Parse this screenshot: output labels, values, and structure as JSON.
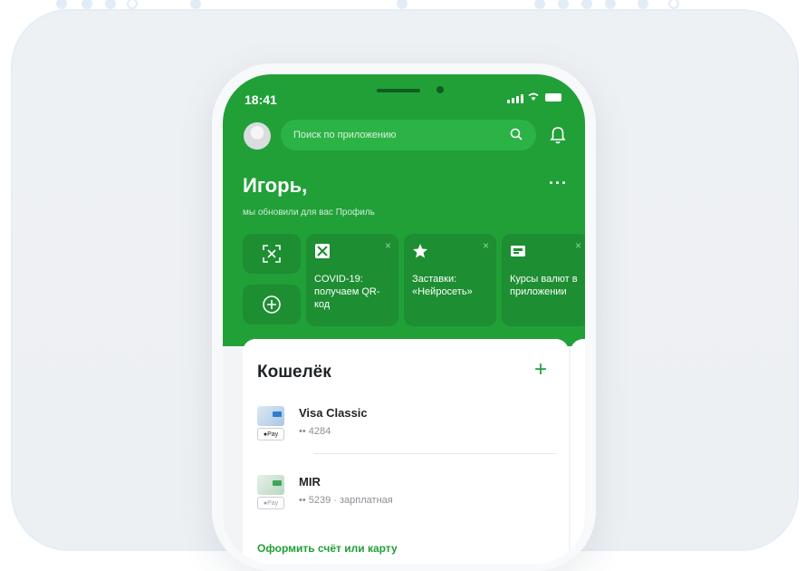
{
  "status_bar": {
    "time": "18:41"
  },
  "header": {
    "search_placeholder": "Поиск по приложению",
    "greeting_name": "Игорь,",
    "greeting_subtitle": "мы обновили для вас Профиль",
    "more_label": "···"
  },
  "story_cards": [
    {
      "icon": "qr-code-icon",
      "title": "COVID-19: получаем QR-код",
      "close": "×"
    },
    {
      "icon": "star-icon",
      "title": "Заставки: «Нейросеть»",
      "close": "×"
    },
    {
      "icon": "currency-icon",
      "title": "Курсы валют в приложении",
      "close": "×"
    }
  ],
  "wallet": {
    "title": "Кошелёк",
    "add_label": "+",
    "items": [
      {
        "name": "Visa Classic",
        "number": "•• 4284",
        "pay_badge": "●Pay"
      },
      {
        "name": "MIR",
        "number": "•• 5239 · зарплатная",
        "pay_badge": "●Pay"
      }
    ],
    "open_link": "Оформить счёт или карту"
  },
  "colors": {
    "brand_green": "#21a038",
    "card_green": "#1d8e32",
    "search_green": "#2cb345"
  }
}
